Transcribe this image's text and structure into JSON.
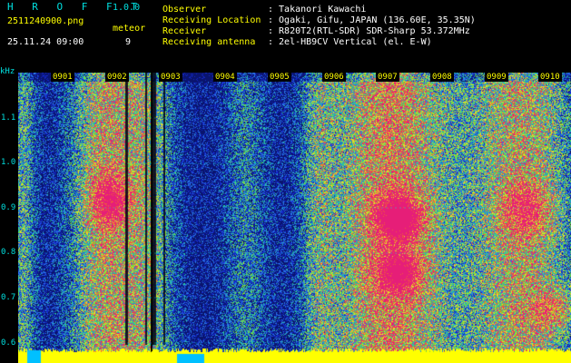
{
  "app": {
    "title": "H R O F F T",
    "version": "1.0.0"
  },
  "file": {
    "name": "2511240900.png",
    "datetime": "25.11.24 09:00"
  },
  "meteor": {
    "label": "meteor",
    "count": "9"
  },
  "info": [
    {
      "key": "Observer",
      "value": ": Takanori Kawachi"
    },
    {
      "key": "Receiving Location",
      "value": ": Ogaki, Gifu, JAPAN (136.60E, 35.35N)"
    },
    {
      "key": "Receiver",
      "value": ": R820T2(RTL-SDR) SDR-Sharp 53.372MHz"
    },
    {
      "key": "Receiving antenna",
      "value": ": 2el-HB9CV Vertical (el. E-W)"
    }
  ],
  "axes": {
    "y_unit": "kHz",
    "y_ticks": [
      "1.1",
      "1.0",
      "0.9",
      "0.8",
      "0.7",
      "0.6"
    ],
    "x_ticks": [
      "0901",
      "0902",
      "0903",
      "0904",
      "0905",
      "0906",
      "0907",
      "0908",
      "0909",
      "0910"
    ]
  },
  "colors": {
    "accent_cyan": "#00e0e0",
    "label_yellow": "#ffff00",
    "baseline": "#ffff00"
  }
}
